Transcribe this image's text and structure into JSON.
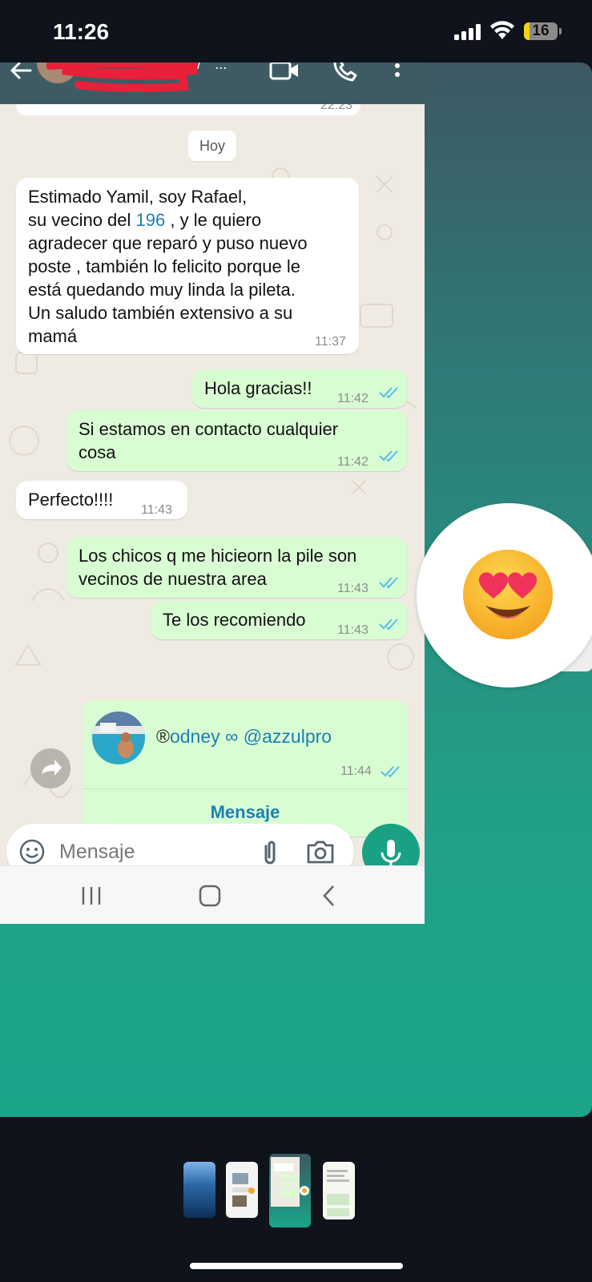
{
  "status_bar": {
    "time": "11:26",
    "battery": "16",
    "battery_level": 0.16
  },
  "header": {
    "partial_text": "/ ° ..."
  },
  "chat": {
    "previous_time": "22:23",
    "date_label": "Hoy",
    "messages": [
      {
        "dir": "in",
        "text": "Estimado Yamil, soy Rafael,",
        "text_pre": "su vecino del ",
        "link": "196",
        "text_post": " , y le quiero\nagradecer que reparó y puso nuevo\nposte , también lo felicito porque le\nestá quedando muy linda la pileta.\nUn saludo también extensivo a su\nmamá",
        "time": "11:37"
      },
      {
        "dir": "out",
        "text": "Hola gracias!!",
        "time": "11:42"
      },
      {
        "dir": "out",
        "text": "Si estamos en contacto cualquier\ncosa",
        "time": "11:42"
      },
      {
        "dir": "in",
        "text": "Perfecto!!!!",
        "time": "11:43"
      },
      {
        "dir": "out",
        "text": "Los chicos q me hicieorn la pile son\nvecinos de nuestra area",
        "time": "11:43"
      },
      {
        "dir": "out",
        "text": "Te los recomiendo",
        "time": "11:43"
      }
    ],
    "contact_card": {
      "name_prefix": "®",
      "name": "odney ∞ @azzulpro",
      "time": "11:44",
      "action": "Mensaje"
    }
  },
  "input": {
    "placeholder": "Mensaje"
  },
  "icons": [
    "back-arrow-icon",
    "video-call-icon",
    "phone-icon",
    "more-vert-icon",
    "forward-icon",
    "emoji-icon",
    "attach-icon",
    "camera-icon",
    "mic-icon",
    "nav-recents-icon",
    "nav-home-icon",
    "nav-back-icon",
    "heart-eyes-emoji-icon"
  ],
  "colors": {
    "chat_bg": "#efeae2",
    "outgoing_bubble": "#d9fdd3",
    "incoming_bubble": "#ffffff",
    "link": "#1d7fb0",
    "ticks": "#53bdeb",
    "accent_green": "#1aa183"
  }
}
